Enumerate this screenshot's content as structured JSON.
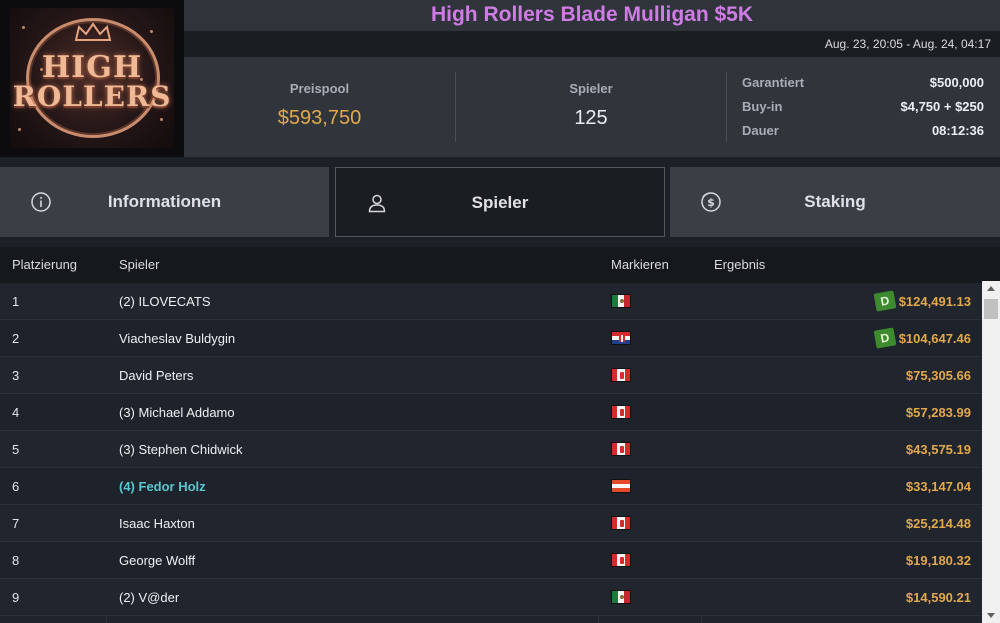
{
  "logo": {
    "line1": "HIGH",
    "line2": "ROLLERS"
  },
  "tournament": {
    "title": "High Rollers Blade Mulligan $5K",
    "dates": "Aug. 23, 20:05 - Aug. 24, 04:17"
  },
  "stats": {
    "prizepool_label": "Preispool",
    "prizepool_value": "$593,750",
    "players_label": "Spieler",
    "players_value": "125",
    "details": [
      {
        "label": "Garantiert",
        "value": "$500,000"
      },
      {
        "label": "Buy-in",
        "value": "$4,750 + $250"
      },
      {
        "label": "Dauer",
        "value": "08:12:36"
      }
    ]
  },
  "tabs": [
    {
      "label": "Informationen",
      "icon": "info-icon",
      "active": false
    },
    {
      "label": "Spieler",
      "icon": "user-icon",
      "active": true
    },
    {
      "label": "Staking",
      "icon": "dollar-coin-icon",
      "active": false
    }
  ],
  "table": {
    "headers": {
      "place": "Platzierung",
      "player": "Spieler",
      "flag": "Markieren",
      "result": "Ergebnis"
    },
    "badge_label": "D",
    "rows": [
      {
        "place": "1",
        "name": "(2) ILOVECATS",
        "flag": "mexico",
        "result": "$124,491.13",
        "badge": true,
        "highlight": false
      },
      {
        "place": "2",
        "name": "Viacheslav Buldygin",
        "flag": "croatia",
        "result": "$104,647.46",
        "badge": true,
        "highlight": false
      },
      {
        "place": "3",
        "name": "David Peters",
        "flag": "canada",
        "result": "$75,305.66",
        "badge": false,
        "highlight": false
      },
      {
        "place": "4",
        "name": "(3) Michael Addamo",
        "flag": "canada",
        "result": "$57,283.99",
        "badge": false,
        "highlight": false
      },
      {
        "place": "5",
        "name": "(3) Stephen Chidwick",
        "flag": "canada",
        "result": "$43,575.19",
        "badge": false,
        "highlight": false
      },
      {
        "place": "6",
        "name": "(4) Fedor Holz",
        "flag": "austria",
        "result": "$33,147.04",
        "badge": false,
        "highlight": true
      },
      {
        "place": "7",
        "name": "Isaac Haxton",
        "flag": "canada",
        "result": "$25,214.48",
        "badge": false,
        "highlight": false
      },
      {
        "place": "8",
        "name": "George Wolff",
        "flag": "canada",
        "result": "$19,180.32",
        "badge": false,
        "highlight": false
      },
      {
        "place": "9",
        "name": "(2) V@der",
        "flag": "mexico",
        "result": "$14,590.21",
        "badge": false,
        "highlight": false
      }
    ]
  },
  "colors": {
    "accent_title": "#d07ce6",
    "money": "#e2a84c",
    "highlight_name": "#58c7d0",
    "badge": "#3e8a2e"
  }
}
